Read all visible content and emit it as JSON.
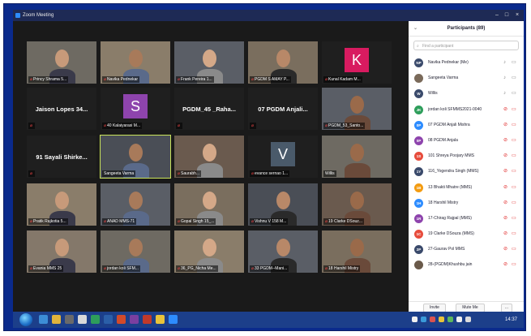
{
  "window": {
    "title": "Zoom Meeting",
    "controls": [
      "–",
      "□",
      "×"
    ]
  },
  "gallery": {
    "tiles": [
      {
        "name": "Princy Shrama 5...",
        "muted": true
      },
      {
        "name": "Navika Pednekar",
        "muted": true
      },
      {
        "name": "Frank Pereira 1...",
        "muted": true
      },
      {
        "name": "PGDM S AMAY P...",
        "muted": true
      },
      {
        "name": "Kunal Kadam M...",
        "muted": true,
        "avatar": "K",
        "avatar_color": "#d81b60"
      },
      {
        "name": "Jaison Lopes 34...",
        "big": true
      },
      {
        "name": "40 Kalaiyarasi M...",
        "muted": true,
        "avatar": "S",
        "avatar_color": "#8e44ad"
      },
      {
        "name": "PGDM_45 _Raha...",
        "big": true
      },
      {
        "name": "07 PGDM Anjali...",
        "big": true
      },
      {
        "name": "PGDM_53_Santo...",
        "muted": true
      },
      {
        "name": "91 Sayali Shirke...",
        "big": true
      },
      {
        "name": "Sangeeta Varma",
        "muted": false
      },
      {
        "name": "Saurabh...",
        "muted": true
      },
      {
        "name": "evance sernao 1...",
        "muted": true,
        "avatar": "V",
        "avatar_color": "#4a5a6a"
      },
      {
        "name": "Willis",
        "muted": false
      },
      {
        "name": "Pratik Rajkotia 5...",
        "muted": true
      },
      {
        "name": "ANAD MMS-71",
        "muted": true
      },
      {
        "name": "Gopal Singh 15_...",
        "muted": true
      },
      {
        "name": "Vishnu V 158 M...",
        "muted": true
      },
      {
        "name": "19 Clarke DSouz...",
        "muted": true
      },
      {
        "name": "Evania MMS 25",
        "muted": true
      },
      {
        "name": "jordan koli SFM...",
        "muted": true
      },
      {
        "name": "36_PG_Nicha Me...",
        "muted": true
      },
      {
        "name": "33 PGDM--Mani...",
        "muted": true
      },
      {
        "name": "18 Harshil Mistry",
        "muted": true
      }
    ]
  },
  "participants": {
    "header": "Participants (89)",
    "search_placeholder": "Find a participant",
    "items": [
      {
        "initials": "NP",
        "name": "Navika Pednekar (Me)",
        "color": "#3a4a6b",
        "mic": "on"
      },
      {
        "initials": "",
        "name": "Sangeeta Varma",
        "color": "#7a6a5a",
        "mic": "on"
      },
      {
        "initials": "W",
        "name": "Willis",
        "color": "#3a4a6b",
        "mic": "on"
      },
      {
        "initials": "JK",
        "name": "jordan koli SFMMS2021-0040",
        "color": "#2e9e5b",
        "mic": "off"
      },
      {
        "initials": "0P",
        "name": "07 PGDM Anjali Mishra",
        "color": "#2d8cff",
        "mic": "off"
      },
      {
        "initials": "0P",
        "name": "08 PGDM Anjala",
        "color": "#8e44ad",
        "mic": "off"
      },
      {
        "initials": "1S",
        "name": "101 Shreya Poojary MMS",
        "color": "#e74c3c",
        "mic": "off"
      },
      {
        "initials": "1Y",
        "name": "116_Yogendra Singh (MMS)",
        "color": "#3a4a6b",
        "mic": "off"
      },
      {
        "initials": "1B",
        "name": "13 Bhakti Mhatre (MMS)",
        "color": "#f39c12",
        "mic": "off"
      },
      {
        "initials": "1H",
        "name": "18 Harshil Mistry",
        "color": "#2d8cff",
        "mic": "off"
      },
      {
        "initials": "1R",
        "name": "17-Chirag Rajpal (MMS)",
        "color": "#8e44ad",
        "mic": "off"
      },
      {
        "initials": "1C",
        "name": "19 Clarke DSouza (MMS)",
        "color": "#e74c3c",
        "mic": "off"
      },
      {
        "initials": "2P",
        "name": "27-Gaurav Pol MMS",
        "color": "#3a4a6b",
        "mic": "off"
      },
      {
        "initials": "",
        "name": "28-(PGDM)Khushbu jain",
        "color": "#6a5a4a",
        "mic": "off"
      }
    ],
    "footer": {
      "invite": "Invite",
      "mute_me": "Mute Me",
      "more": "..."
    }
  },
  "taskbar": {
    "clock": "14:37"
  },
  "colors": {
    "frame": "#0a2a8c",
    "accent": "#2d8cff",
    "muted": "#ff4a4a"
  }
}
